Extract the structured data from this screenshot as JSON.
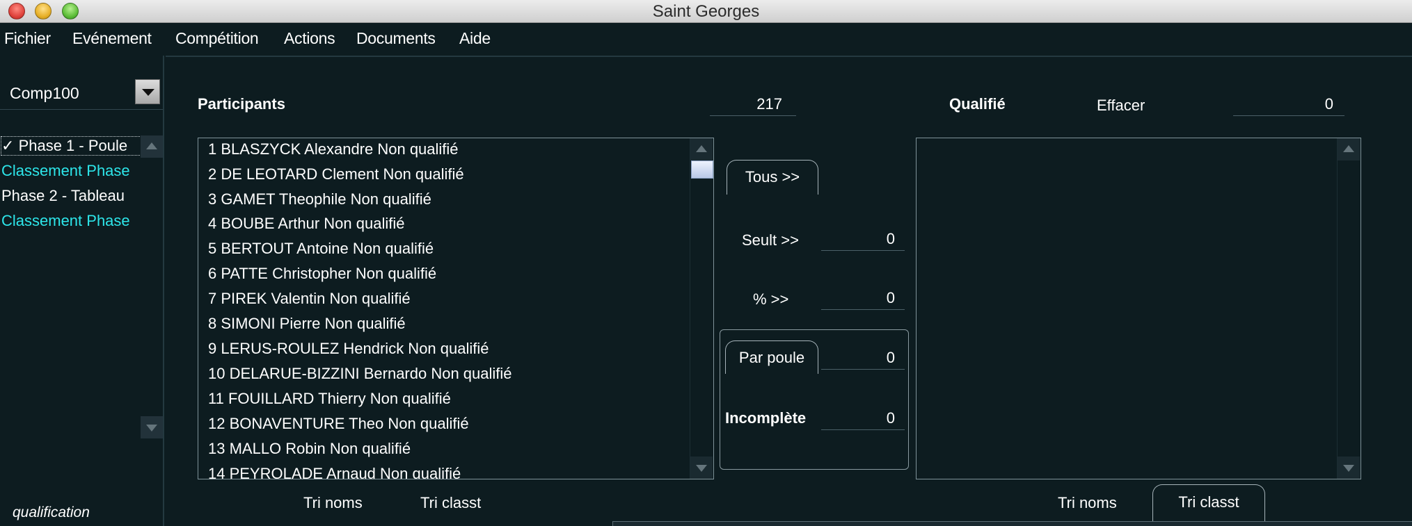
{
  "window": {
    "title": "Saint Georges"
  },
  "menu": [
    "Fichier",
    "Evénement",
    "Compétition",
    "Actions",
    "Documents",
    "Aide"
  ],
  "sidebar": {
    "competition_select": "Comp100",
    "phases": [
      {
        "label": "Phase 1 - Poule",
        "checked": true,
        "color": "#ffffff"
      },
      {
        "label": "Classement Phase",
        "checked": false,
        "color": "#2de6ea"
      },
      {
        "label": "Phase 2 - Tableau",
        "checked": false,
        "color": "#ffffff"
      },
      {
        "label": "Classement Phase",
        "checked": false,
        "color": "#2de6ea"
      }
    ],
    "footer_label": "qualification"
  },
  "participants": {
    "title": "Participants",
    "count": "217",
    "rows": [
      "1 BLASZYCK Alexandre Non qualifié",
      "2 DE LEOTARD Clement Non qualifié",
      "3 GAMET Theophile Non qualifié",
      "4 BOUBE Arthur Non qualifié",
      "5 BERTOUT Antoine Non qualifié",
      "6 PATTE Christopher Non qualifié",
      "7 PIREK Valentin Non qualifié",
      "8 SIMONI Pierre Non qualifié",
      "9 LERUS-ROULEZ Hendrick Non qualifié",
      "10 DELARUE-BIZZINI Bernardo Non qualifié",
      "11 FOUILLARD Thierry Non qualifié",
      "12 BONAVENTURE Theo Non qualifié",
      "13 MALLO Robin Non qualifié",
      "14 PEYROLADE Arnaud Non qualifié"
    ],
    "sort_names": "Tri noms",
    "sort_rank": "Tri classt"
  },
  "controls": {
    "all": "Tous >>",
    "threshold_label": "Seult >>",
    "threshold_value": "0",
    "percent_label": "% >>",
    "percent_value": "0",
    "per_pool_label": "Par poule",
    "per_pool_value": "0",
    "incomplete_label": "Incomplète",
    "incomplete_value": "0"
  },
  "qualified": {
    "title": "Qualifié",
    "clear_label": "Effacer",
    "count": "0",
    "sort_names": "Tri noms",
    "sort_rank": "Tri classt"
  }
}
